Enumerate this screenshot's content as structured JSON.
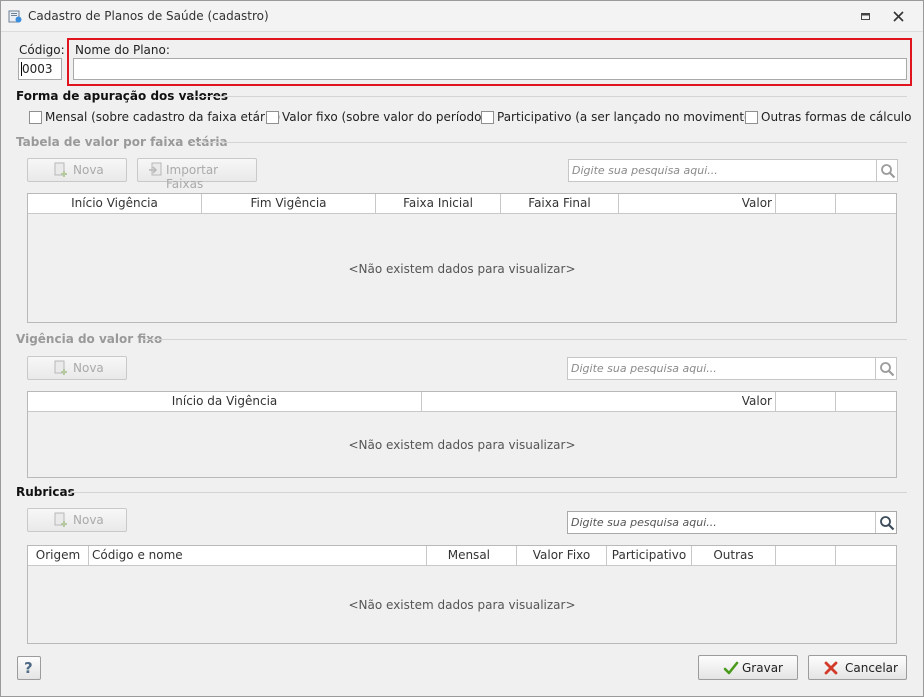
{
  "window": {
    "title": "Cadastro de Planos de Saúde (cadastro)"
  },
  "form": {
    "codigo_label": "Código:",
    "codigo_value": "0003",
    "nome_label": "Nome do Plano:",
    "nome_value": ""
  },
  "apuracao": {
    "title": "Forma de apuração dos valores",
    "options": [
      {
        "label": "Mensal (sobre cadastro da faixa etária)",
        "checked": false
      },
      {
        "label": "Valor fixo (sobre valor do período)",
        "checked": false
      },
      {
        "label": "Participativo (a ser lançado no movimento)",
        "checked": false
      },
      {
        "label": "Outras formas de cálculo",
        "checked": false
      }
    ]
  },
  "faixa": {
    "title": "Tabela de valor por faixa etária",
    "nova_label": "Nova",
    "importar_label": "Importar Faixas",
    "search_placeholder": "Digite sua pesquisa aqui...",
    "columns": [
      "Início Vigência",
      "Fim Vigência",
      "Faixa Inicial",
      "Faixa Final",
      "Valor"
    ],
    "empty": "<Não existem dados para visualizar>"
  },
  "vigencia": {
    "title": "Vigência do valor fixo",
    "nova_label": "Nova",
    "search_placeholder": "Digite sua pesquisa aqui...",
    "columns": [
      "Início da Vigência",
      "Valor"
    ],
    "empty": "<Não existem dados para visualizar>"
  },
  "rubricas": {
    "title": "Rubricas",
    "nova_label": "Nova",
    "search_placeholder": "Digite sua pesquisa aqui...",
    "columns": [
      "Origem",
      "Código e nome",
      "Mensal",
      "Valor Fixo",
      "Participativo",
      "Outras"
    ],
    "empty": "<Não existem dados para visualizar>"
  },
  "footer": {
    "help_label": "?",
    "gravar_label": "Gravar",
    "cancelar_label": "Cancelar"
  },
  "colors": {
    "focus_border": "#e0141e",
    "ok_green": "#4a9a1c",
    "cancel_red": "#d23a2a"
  }
}
